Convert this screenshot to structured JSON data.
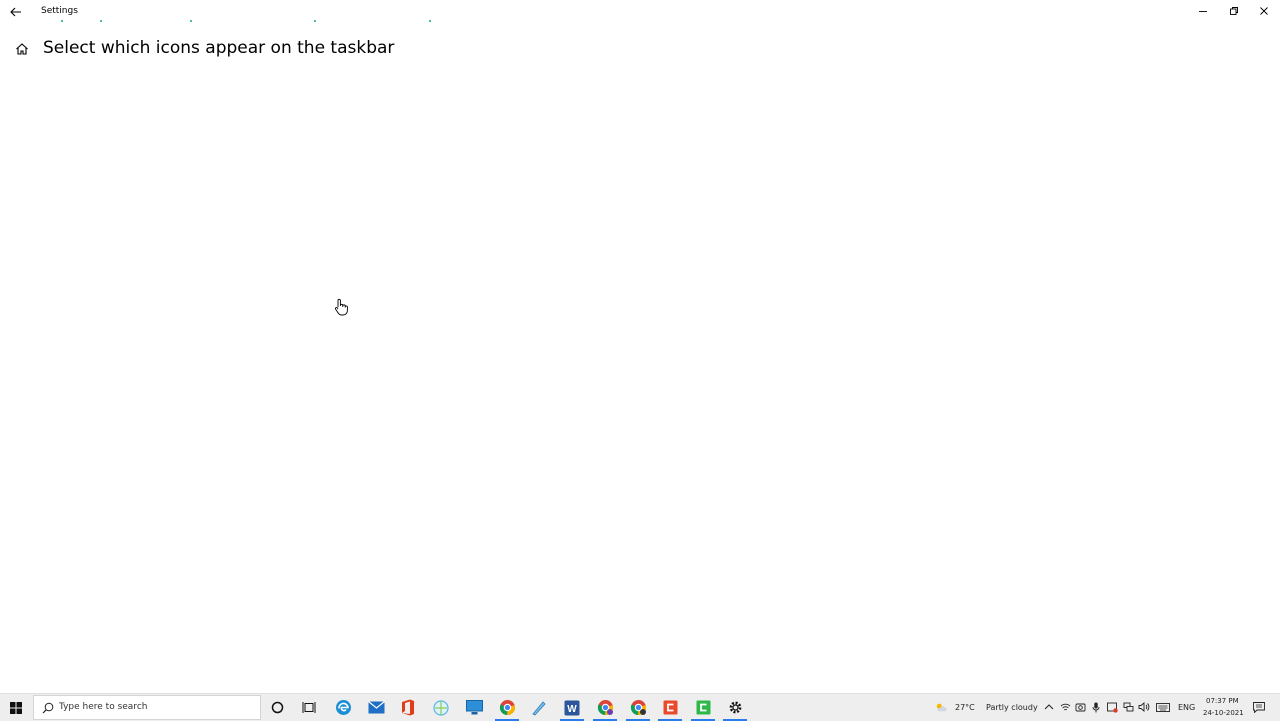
{
  "window": {
    "title": "Settings"
  },
  "page": {
    "title": "Select which icons appear on the taskbar"
  },
  "taskbar": {
    "search_placeholder": "Type here to search",
    "weather_temp": "27°C",
    "weather_desc": "Partly cloudy",
    "language": "ENG",
    "time": "07:37 PM",
    "date": "24-10-2021",
    "pinned": [
      {
        "name": "cortana-icon"
      },
      {
        "name": "task-view-icon"
      },
      {
        "name": "edge-icon"
      },
      {
        "name": "mail-icon"
      },
      {
        "name": "office-icon"
      },
      {
        "name": "browser-icon"
      },
      {
        "name": "remote-desktop-icon"
      },
      {
        "name": "chrome-icon"
      },
      {
        "name": "app-icon"
      },
      {
        "name": "word-icon"
      },
      {
        "name": "chrome-profile-icon"
      },
      {
        "name": "chrome-profile-2-icon"
      },
      {
        "name": "app-red-icon"
      },
      {
        "name": "app-green-icon"
      },
      {
        "name": "settings-gear-icon"
      }
    ]
  },
  "colors": {
    "accent": "#2b7de9",
    "taskbar": "#eeeeee",
    "progress_dots": "#1fa870"
  }
}
